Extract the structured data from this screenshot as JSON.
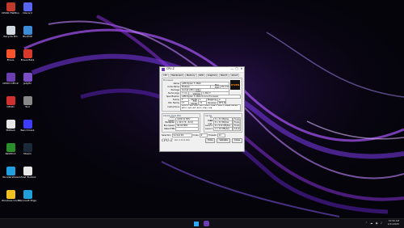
{
  "desktop": {
    "icons": [
      {
        "label": "CPUID HWMonitor",
        "color": "#c0392b"
      },
      {
        "label": "Discord",
        "color": "#5865f2"
      },
      {
        "label": "Recycle Bin",
        "color": "#d0d8e0"
      },
      {
        "label": "Bin/Edit",
        "color": "#3b8bd6"
      },
      {
        "label": "Brave",
        "color": "#fb542b"
      },
      {
        "label": "Brave Beta",
        "color": "#d8392a"
      },
      {
        "label": "CPUID CPU-Z",
        "color": "#6a3db0"
      },
      {
        "label": "Jellyfin",
        "color": "#7b4ec8"
      },
      {
        "label": "CPUID",
        "color": "#d03030"
      },
      {
        "label": "Tool",
        "color": "#888888"
      },
      {
        "label": "3DMark",
        "color": "#e6e6e6"
      },
      {
        "label": "Benchmark",
        "color": "#3c3cff"
      },
      {
        "label": "NetWork",
        "color": "#2a8f2a"
      },
      {
        "label": "Steam",
        "color": "#1b2838"
      },
      {
        "label": "Wondershare",
        "color": "#20a0e0"
      },
      {
        "label": "Ghost Toolbox",
        "color": "#e8e8e8"
      },
      {
        "label": "Windows Configurat...",
        "color": "#f0c020"
      },
      {
        "label": "Microsoft Edge",
        "color": "#1fa0d8"
      }
    ]
  },
  "cpuz": {
    "title": "CPU-Z",
    "minimize": "—",
    "maximize": "□",
    "close": "✕",
    "tabs": [
      "CPU",
      "Mainboard",
      "Memory",
      "SPD",
      "Graphics",
      "Bench",
      "About"
    ],
    "processor": {
      "group": "Processor",
      "name_label": "Name",
      "name": "AMD Ryzen 5 3600",
      "codename_label": "Code Name",
      "codename": "Matisse",
      "maxtdp_label": "Max TDP",
      "maxtdp": "65.0 W",
      "package_label": "Package",
      "package": "Socket AM4 (1331)",
      "technology_label": "Technology",
      "technology": "7 nm",
      "voltage_label": "Core Voltage",
      "voltage": "1.362 V",
      "spec_label": "Specification",
      "spec": "AMD Ryzen 5 3600 6-Core Processor",
      "family_label": "Family",
      "family": "F",
      "model_label": "Model",
      "model": "1",
      "stepping_label": "Stepping",
      "stepping": "0",
      "extfamily_label": "Ext. Family",
      "extfamily": "17",
      "extmodel_label": "Ext. Model",
      "extmodel": "71",
      "revision_label": "Revision",
      "revision": "MTS-B0",
      "instructions_label": "Instructions",
      "instructions": "MMX(+), SSE, SSE2, SSE3, SSSE3, SSE4.1, SSE4.2, SSE4A, x86-64, AMD-V, AES, AVX, AVX2, FMA3, SHA",
      "logo": "RYZEN"
    },
    "clocks": {
      "group": "Clocks (Core #0)",
      "corespeed_label": "Core Speed",
      "corespeed": "4196.52 MHz",
      "multiplier_label": "Multiplier",
      "multiplier": "x 42.0 (5 - 42.0)",
      "busspeed_label": "Bus Speed",
      "busspeed": "99.92 MHz",
      "ratedfsb_label": "Rated FSB",
      "ratedfsb": ""
    },
    "cache": {
      "group": "Cache",
      "l1d_label": "L1 Data",
      "l1d": "6 x 32 KBytes",
      "l1d_way": "8-way",
      "l1i_label": "L1 Inst.",
      "l1i": "6 x 32 KBytes",
      "l1i_way": "8-way",
      "l2_label": "Level 2",
      "l2": "6 x 512 KBytes",
      "l2_way": "8-way",
      "l3_label": "Level 3",
      "l3": "2 x 16 MBytes",
      "l3_way": "16-way"
    },
    "selection_label": "Selection",
    "selection": "Socket #1",
    "cores_label": "Cores",
    "cores": "6",
    "threads_label": "Threads",
    "threads": "12",
    "brand": "CPU-Z",
    "version": "Ver. 2.11.0.x64",
    "tools_btn": "Tools",
    "validate_btn": "Validate",
    "close_btn": "Close"
  },
  "taskbar": {
    "time": "10:56 AM",
    "date": "1/21/2025",
    "tray": "⌃ ☁ ◉ ♪"
  }
}
